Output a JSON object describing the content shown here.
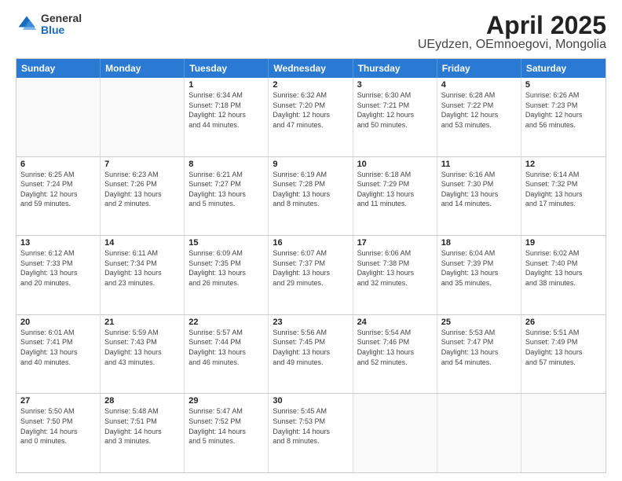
{
  "logo": {
    "general": "General",
    "blue": "Blue"
  },
  "title": "April 2025",
  "location": "UEydzen, OEmnoegovi, Mongolia",
  "dayHeaders": [
    "Sunday",
    "Monday",
    "Tuesday",
    "Wednesday",
    "Thursday",
    "Friday",
    "Saturday"
  ],
  "weeks": [
    [
      {
        "day": "",
        "info": ""
      },
      {
        "day": "",
        "info": ""
      },
      {
        "day": "1",
        "info": "Sunrise: 6:34 AM\nSunset: 7:18 PM\nDaylight: 12 hours\nand 44 minutes."
      },
      {
        "day": "2",
        "info": "Sunrise: 6:32 AM\nSunset: 7:20 PM\nDaylight: 12 hours\nand 47 minutes."
      },
      {
        "day": "3",
        "info": "Sunrise: 6:30 AM\nSunset: 7:21 PM\nDaylight: 12 hours\nand 50 minutes."
      },
      {
        "day": "4",
        "info": "Sunrise: 6:28 AM\nSunset: 7:22 PM\nDaylight: 12 hours\nand 53 minutes."
      },
      {
        "day": "5",
        "info": "Sunrise: 6:26 AM\nSunset: 7:23 PM\nDaylight: 12 hours\nand 56 minutes."
      }
    ],
    [
      {
        "day": "6",
        "info": "Sunrise: 6:25 AM\nSunset: 7:24 PM\nDaylight: 12 hours\nand 59 minutes."
      },
      {
        "day": "7",
        "info": "Sunrise: 6:23 AM\nSunset: 7:26 PM\nDaylight: 13 hours\nand 2 minutes."
      },
      {
        "day": "8",
        "info": "Sunrise: 6:21 AM\nSunset: 7:27 PM\nDaylight: 13 hours\nand 5 minutes."
      },
      {
        "day": "9",
        "info": "Sunrise: 6:19 AM\nSunset: 7:28 PM\nDaylight: 13 hours\nand 8 minutes."
      },
      {
        "day": "10",
        "info": "Sunrise: 6:18 AM\nSunset: 7:29 PM\nDaylight: 13 hours\nand 11 minutes."
      },
      {
        "day": "11",
        "info": "Sunrise: 6:16 AM\nSunset: 7:30 PM\nDaylight: 13 hours\nand 14 minutes."
      },
      {
        "day": "12",
        "info": "Sunrise: 6:14 AM\nSunset: 7:32 PM\nDaylight: 13 hours\nand 17 minutes."
      }
    ],
    [
      {
        "day": "13",
        "info": "Sunrise: 6:12 AM\nSunset: 7:33 PM\nDaylight: 13 hours\nand 20 minutes."
      },
      {
        "day": "14",
        "info": "Sunrise: 6:11 AM\nSunset: 7:34 PM\nDaylight: 13 hours\nand 23 minutes."
      },
      {
        "day": "15",
        "info": "Sunrise: 6:09 AM\nSunset: 7:35 PM\nDaylight: 13 hours\nand 26 minutes."
      },
      {
        "day": "16",
        "info": "Sunrise: 6:07 AM\nSunset: 7:37 PM\nDaylight: 13 hours\nand 29 minutes."
      },
      {
        "day": "17",
        "info": "Sunrise: 6:06 AM\nSunset: 7:38 PM\nDaylight: 13 hours\nand 32 minutes."
      },
      {
        "day": "18",
        "info": "Sunrise: 6:04 AM\nSunset: 7:39 PM\nDaylight: 13 hours\nand 35 minutes."
      },
      {
        "day": "19",
        "info": "Sunrise: 6:02 AM\nSunset: 7:40 PM\nDaylight: 13 hours\nand 38 minutes."
      }
    ],
    [
      {
        "day": "20",
        "info": "Sunrise: 6:01 AM\nSunset: 7:41 PM\nDaylight: 13 hours\nand 40 minutes."
      },
      {
        "day": "21",
        "info": "Sunrise: 5:59 AM\nSunset: 7:43 PM\nDaylight: 13 hours\nand 43 minutes."
      },
      {
        "day": "22",
        "info": "Sunrise: 5:57 AM\nSunset: 7:44 PM\nDaylight: 13 hours\nand 46 minutes."
      },
      {
        "day": "23",
        "info": "Sunrise: 5:56 AM\nSunset: 7:45 PM\nDaylight: 13 hours\nand 49 minutes."
      },
      {
        "day": "24",
        "info": "Sunrise: 5:54 AM\nSunset: 7:46 PM\nDaylight: 13 hours\nand 52 minutes."
      },
      {
        "day": "25",
        "info": "Sunrise: 5:53 AM\nSunset: 7:47 PM\nDaylight: 13 hours\nand 54 minutes."
      },
      {
        "day": "26",
        "info": "Sunrise: 5:51 AM\nSunset: 7:49 PM\nDaylight: 13 hours\nand 57 minutes."
      }
    ],
    [
      {
        "day": "27",
        "info": "Sunrise: 5:50 AM\nSunset: 7:50 PM\nDaylight: 14 hours\nand 0 minutes."
      },
      {
        "day": "28",
        "info": "Sunrise: 5:48 AM\nSunset: 7:51 PM\nDaylight: 14 hours\nand 3 minutes."
      },
      {
        "day": "29",
        "info": "Sunrise: 5:47 AM\nSunset: 7:52 PM\nDaylight: 14 hours\nand 5 minutes."
      },
      {
        "day": "30",
        "info": "Sunrise: 5:45 AM\nSunset: 7:53 PM\nDaylight: 14 hours\nand 8 minutes."
      },
      {
        "day": "",
        "info": ""
      },
      {
        "day": "",
        "info": ""
      },
      {
        "day": "",
        "info": ""
      }
    ]
  ]
}
